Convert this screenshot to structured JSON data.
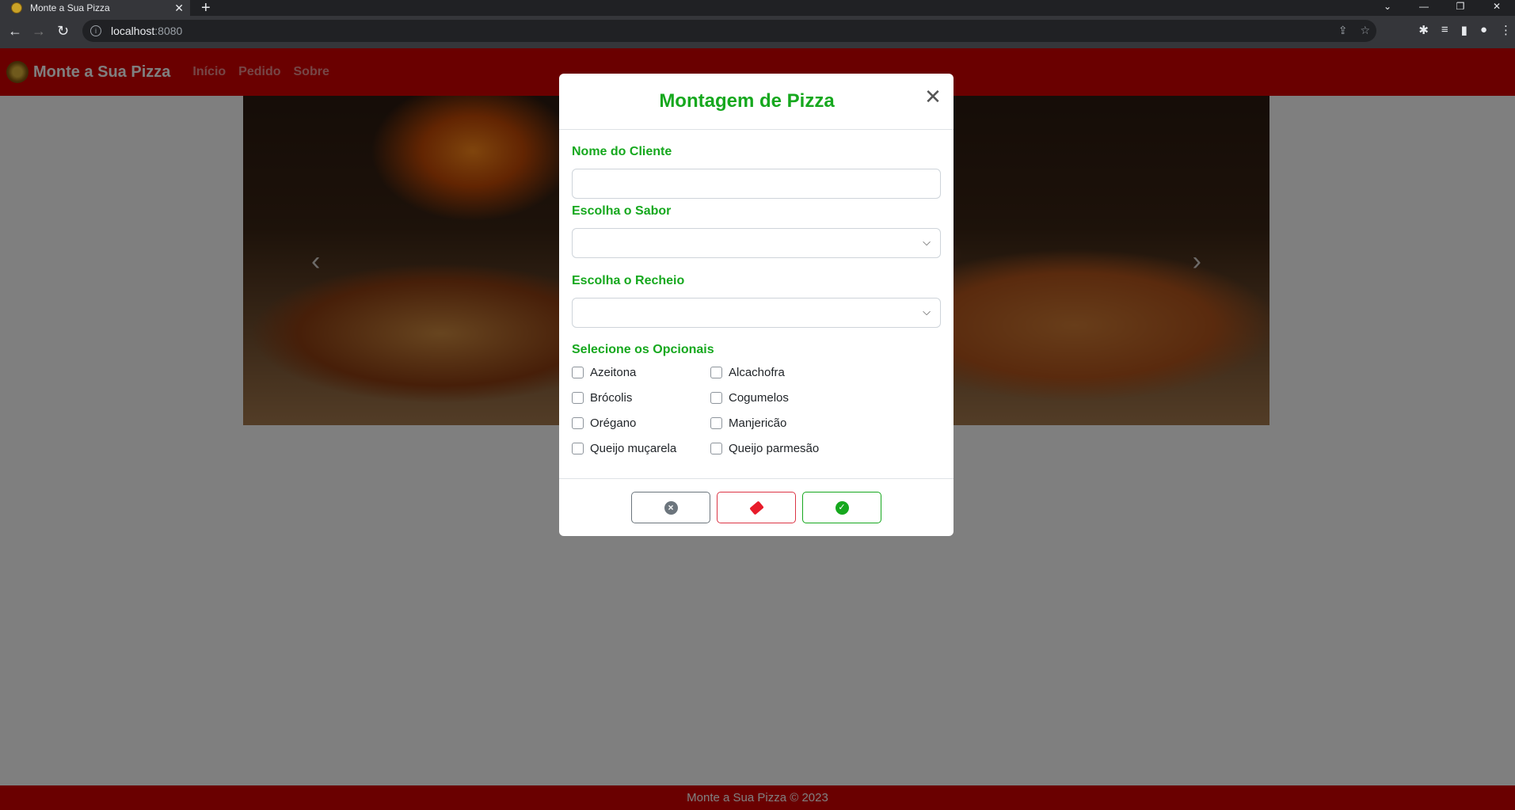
{
  "browser": {
    "tab_title": "Monte a Sua Pizza",
    "url_host": "localhost",
    "url_port": ":8080"
  },
  "navbar": {
    "brand": "Monte a Sua Pizza",
    "links": [
      "Início",
      "Pedido",
      "Sobre"
    ]
  },
  "footer": {
    "text": "Monte a Sua Pizza © 2023"
  },
  "modal": {
    "title": "Montagem de Pizza",
    "fields": {
      "cliente_label": "Nome do Cliente",
      "cliente_value": "",
      "sabor_label": "Escolha o Sabor",
      "sabor_value": "",
      "recheio_label": "Escolha o Recheio",
      "recheio_value": "",
      "opcionais_label": "Selecione os Opcionais"
    },
    "opcionais": [
      {
        "label": "Azeitona",
        "checked": false
      },
      {
        "label": "Alcachofra",
        "checked": false
      },
      {
        "label": "Brócolis",
        "checked": false
      },
      {
        "label": "Cogumelos",
        "checked": false
      },
      {
        "label": "Orégano",
        "checked": false
      },
      {
        "label": "Manjericão",
        "checked": false
      },
      {
        "label": "Queijo muçarela",
        "checked": false
      },
      {
        "label": "Queijo parmesão",
        "checked": false
      }
    ]
  },
  "colors": {
    "primary_red": "#d50000",
    "accent_green": "#16a81e",
    "danger": "#dc3545",
    "secondary": "#6c757d"
  }
}
